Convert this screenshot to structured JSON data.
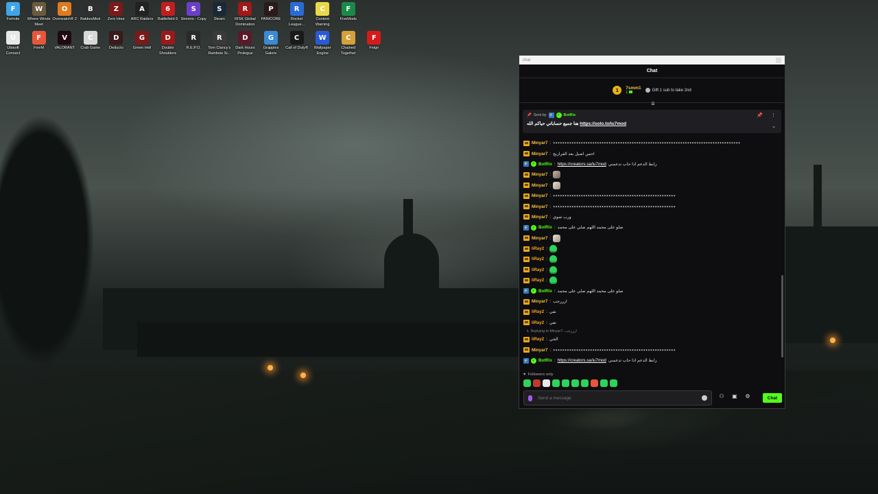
{
  "desktop": {
    "icons": [
      {
        "label": "Fortnite",
        "color": "#3fa4e8",
        "glyph": "F"
      },
      {
        "label": "Where Winds Meet",
        "color": "#6b5a3d",
        "glyph": "W"
      },
      {
        "label": "Overwatch® 2",
        "color": "#e07a1f",
        "glyph": "O"
      },
      {
        "label": "BakkesMod",
        "color": "#2f2f2f",
        "glyph": "B"
      },
      {
        "label": "Zero Hour",
        "color": "#7a1a1a",
        "glyph": "Z"
      },
      {
        "label": "ARC Raiders",
        "color": "#222222",
        "glyph": "A"
      },
      {
        "label": "Battlefield 6",
        "color": "#c21e1e",
        "glyph": "6"
      },
      {
        "label": "Stremio - Copy",
        "color": "#6a3fc7",
        "glyph": "S"
      },
      {
        "label": "Steam",
        "color": "#1b2838",
        "glyph": "S"
      },
      {
        "label": "RISK Global Domination",
        "color": "#a01818",
        "glyph": "R"
      },
      {
        "label": "PANICORE",
        "color": "#2a1a1a",
        "glyph": "P"
      },
      {
        "label": "Rocket League...",
        "color": "#2a6ad6",
        "glyph": "R"
      },
      {
        "label": "Content Warning",
        "color": "#e8d84a",
        "glyph": "C"
      },
      {
        "label": "FiveMods",
        "color": "#1a8a4a",
        "glyph": "F"
      },
      {
        "label": "Ubisoft Connect",
        "color": "#e8e8e8",
        "glyph": "U"
      },
      {
        "label": "FiveM",
        "color": "#e8563a",
        "glyph": "F"
      },
      {
        "label": "VALORANT",
        "color": "#1f0a10",
        "glyph": "V"
      },
      {
        "label": "Crab Game",
        "color": "#d8d8d8",
        "glyph": "C"
      },
      {
        "label": "Deducto",
        "color": "#3a1a1a",
        "glyph": "D"
      },
      {
        "label": "Green Hell",
        "color": "#7a1a1a",
        "glyph": "G"
      },
      {
        "label": "Double Shoulders",
        "color": "#9a1a1a",
        "glyph": "D"
      },
      {
        "label": "R.E.P.O.",
        "color": "#2a2a2a",
        "glyph": "R"
      },
      {
        "label": "Tom Clancy's Rainbow Si...",
        "color": "#3a3a3a",
        "glyph": "R"
      },
      {
        "label": "Dark Hours Prologue",
        "color": "#5a1a2a",
        "glyph": "D"
      },
      {
        "label": "Grapples Galore",
        "color": "#3a8ad6",
        "glyph": "G"
      },
      {
        "label": "Call of Duty®",
        "color": "#1a1a1a",
        "glyph": "C"
      },
      {
        "label": "Wallpaper Engine",
        "color": "#2a5ad6",
        "glyph": "W"
      },
      {
        "label": "Chained Together",
        "color": "#d6a03a",
        "glyph": "C"
      },
      {
        "label": "Feign",
        "color": "#d61a1a",
        "glyph": "F"
      }
    ]
  },
  "window": {
    "title": "chat"
  },
  "chat": {
    "header": "Chat",
    "top_gifter": {
      "rank": "1",
      "name": "7smm1",
      "count": "1"
    },
    "gift_cta": "Gift 1 sub to take 2nd",
    "pinned": {
      "sent_by_label": "Sent by",
      "sender": "BotRix",
      "text": "هنا جميع حساباتي حياكم الله",
      "link": "https://solo.to/iu7mod"
    },
    "messages": [
      {
        "user": "Minyar7",
        "badge": "crown",
        "color": "#f5c343",
        "text": "٭٭٭٭٭٭٭٭٭٭٭٭٭٭٭٭٭٭٭٭٭٭٭٭٭٭٭٭٭٭٭٭٭٭٭٭٭٭٭٭٭٭٭٭٭٭٭٭٭٭٭٭٭٭٭٭٭٭٭٭٭٭٭٭٭٭٭٭٭٭٭٭٭٭٭٭٭٭٭٭٭",
        "emote": null
      },
      {
        "user": "Minyar7",
        "badge": "crown",
        "color": "#f5c343",
        "text": "احس اضبل بعد الفراريج",
        "emote": null
      },
      {
        "user": "BotRix",
        "badge": "bot",
        "color": "#53fc18",
        "text": "رابط الدعم اذا حاب تدعمني",
        "link": "https://creators.sa/iu7mod",
        "emote": null
      },
      {
        "user": "Minyar7",
        "badge": "crown",
        "color": "#f5c343",
        "text": "",
        "emote": "photo"
      },
      {
        "user": "Minyar7",
        "badge": "crown",
        "color": "#f5c343",
        "text": "",
        "emote": "cat"
      },
      {
        "user": "Minyar7",
        "badge": "crown",
        "color": "#f5c343",
        "text": "٭٭٭٭٭٭٭٭٭٭٭٭٭٭٭٭٭٭٭٭٭٭٭٭٭٭٭٭٭٭٭٭٭٭٭٭٭٭٭٭٭٭٭٭٭٭٭٭٭٭٭٭٭",
        "emote": null
      },
      {
        "user": "Minyar7",
        "badge": "crown",
        "color": "#f5c343",
        "text": "٭٭٭٭٭٭٭٭٭٭٭٭٭٭٭٭٭٭٭٭٭٭٭٭٭٭٭٭٭٭٭٭٭٭٭٭٭٭٭٭٭٭٭٭٭٭٭٭٭٭٭٭٭",
        "emote": null
      },
      {
        "user": "Minyar7",
        "badge": "crown",
        "color": "#f5c343",
        "text": "ورب شوي",
        "emote": null
      },
      {
        "user": "BotRix",
        "badge": "bot",
        "color": "#53fc18",
        "text": "صلو على محمد اللهم صلي على محمد",
        "emote": null
      },
      {
        "user": "Minyar7",
        "badge": "crown",
        "color": "#f5c343",
        "text": "",
        "emote": "cat"
      },
      {
        "user": "liRay2",
        "badge": "crown",
        "color": "#f5a623",
        "text": "",
        "emote": "green"
      },
      {
        "user": "liRay2",
        "badge": "crown",
        "color": "#f5a623",
        "text": "",
        "emote": "green"
      },
      {
        "user": "liRay2",
        "badge": "crown",
        "color": "#f5a623",
        "text": "",
        "emote": "green"
      },
      {
        "user": "liRay2",
        "badge": "crown",
        "color": "#f5a623",
        "text": "",
        "emote": "green"
      },
      {
        "user": "BotRix",
        "badge": "bot",
        "color": "#53fc18",
        "text": "صلو على محمد اللهم صلي على محمد",
        "emote": null
      },
      {
        "user": "Minyar7",
        "badge": "crown",
        "color": "#f5c343",
        "text": "ارررجب",
        "emote": null
      },
      {
        "user": "liRay2",
        "badge": "crown",
        "color": "#f5a623",
        "text": "نفي",
        "emote": null
      },
      {
        "user": "liRay2",
        "badge": "crown",
        "color": "#f5a623",
        "text": "نفي",
        "emote": null
      },
      {
        "user": "liRay2",
        "badge": "crown",
        "color": "#f5a623",
        "text": "الجي",
        "emote": null,
        "reply": "Replying to Minyar7: ارررجب"
      },
      {
        "user": "Minyar7",
        "badge": "crown",
        "color": "#f5c343",
        "text": "٭٭٭٭٭٭٭٭٭٭٭٭٭٭٭٭٭٭٭٭٭٭٭٭٭٭٭٭٭٭٭٭٭٭٭٭٭٭٭٭٭٭٭٭٭٭٭٭٭٭٭٭٭",
        "emote": null
      },
      {
        "user": "BotRix",
        "badge": "bot",
        "color": "#53fc18",
        "text": "رابط الدعم اذا حاب تدعمني",
        "link": "https://creators.sa/iu7mod",
        "emote": null
      }
    ],
    "followers_only": "Followers only",
    "emote_bar": [
      "#2ed35a",
      "#c0392b",
      "#e8e8e8",
      "#2ed35a",
      "#2ed35a",
      "#2ed35a",
      "#2ed35a",
      "#e8563a",
      "#2ed35a",
      "#2ed35a"
    ],
    "input": {
      "placeholder": "Send a message"
    },
    "send_label": "Chat"
  }
}
